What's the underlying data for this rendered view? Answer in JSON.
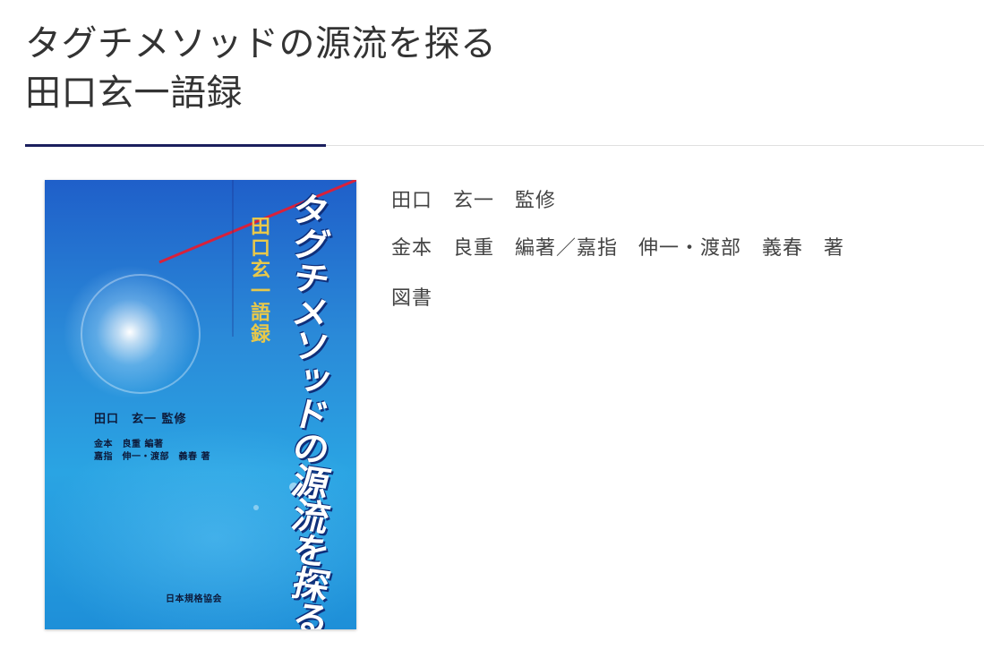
{
  "header": {
    "title_line1": "タグチメソッドの源流を探る",
    "title_line2": "田口玄一語録"
  },
  "book": {
    "supervisor": "田口　玄一　監修",
    "authors": "金本　良重　編著／嘉指　伸一・渡部　義春　著",
    "media_type": "図書"
  },
  "cover": {
    "main_title": "タグチメソッドの源流を探る",
    "sub_title": "田口玄一語録",
    "credit_supervisor": "田口　玄一 監修",
    "credit_editor": "金本　良重 編著",
    "credit_authors": "嘉指　伸一・渡部　義春 著",
    "publisher": "日本規格協会"
  },
  "colors": {
    "accent": "#1b1f5e",
    "cover_blue": "#2a8ad8",
    "cover_stripe": "#d8213b",
    "cover_subtitle": "#e8c84a"
  }
}
